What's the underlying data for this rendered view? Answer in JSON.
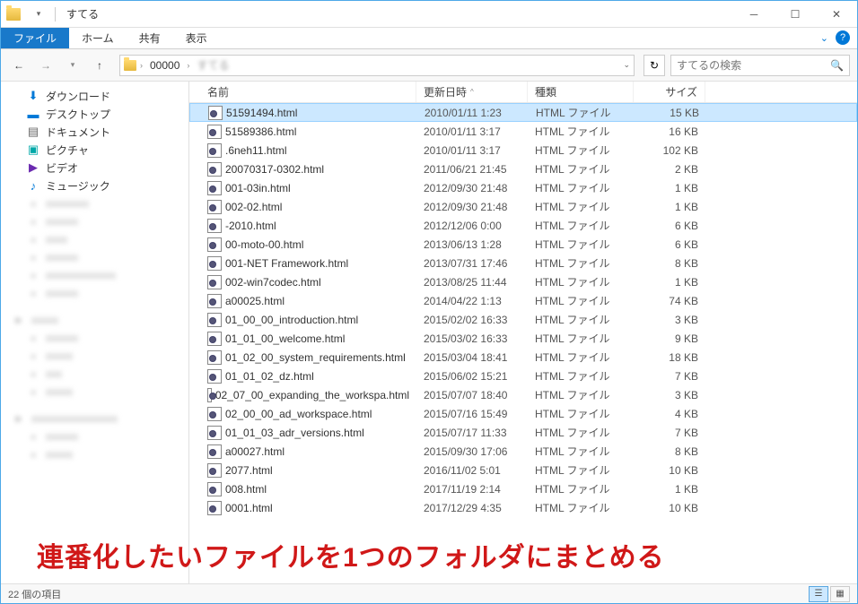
{
  "title": "すてる",
  "ribbon": {
    "file": "ファイル",
    "home": "ホーム",
    "share": "共有",
    "view": "表示"
  },
  "nav": {
    "crumb1": "00000",
    "crumb2": "すてる",
    "search_placeholder": "すてるの検索"
  },
  "sidebar": {
    "downloads": "ダウンロード",
    "desktop": "デスクトップ",
    "documents": "ドキュメント",
    "pictures": "ピクチャ",
    "videos": "ビデオ",
    "music": "ミュージック"
  },
  "columns": {
    "name": "名前",
    "date": "更新日時",
    "type": "種類",
    "size": "サイズ"
  },
  "files": [
    {
      "name": "51591494.html",
      "date": "2010/01/11 1:23",
      "type": "HTML ファイル",
      "size": "15 KB",
      "sel": true
    },
    {
      "name": "51589386.html",
      "date": "2010/01/11 3:17",
      "type": "HTML ファイル",
      "size": "16 KB"
    },
    {
      "name": ".6neh11.html",
      "date": "2010/01/11 3:17",
      "type": "HTML ファイル",
      "size": "102 KB"
    },
    {
      "name": "20070317-0302.html",
      "date": "2011/06/21 21:45",
      "type": "HTML ファイル",
      "size": "2 KB"
    },
    {
      "name": "001-03in.html",
      "date": "2012/09/30 21:48",
      "type": "HTML ファイル",
      "size": "1 KB"
    },
    {
      "name": "002-02.html",
      "date": "2012/09/30 21:48",
      "type": "HTML ファイル",
      "size": "1 KB"
    },
    {
      "name": "-2010.html",
      "date": "2012/12/06 0:00",
      "type": "HTML ファイル",
      "size": "6 KB"
    },
    {
      "name": "00-moto-00.html",
      "date": "2013/06/13 1:28",
      "type": "HTML ファイル",
      "size": "6 KB"
    },
    {
      "name": "001-NET Framework.html",
      "date": "2013/07/31 17:46",
      "type": "HTML ファイル",
      "size": "8 KB"
    },
    {
      "name": "002-win7codec.html",
      "date": "2013/08/25 11:44",
      "type": "HTML ファイル",
      "size": "1 KB"
    },
    {
      "name": "a00025.html",
      "date": "2014/04/22 1:13",
      "type": "HTML ファイル",
      "size": "74 KB"
    },
    {
      "name": "01_00_00_introduction.html",
      "date": "2015/02/02 16:33",
      "type": "HTML ファイル",
      "size": "3 KB"
    },
    {
      "name": "01_01_00_welcome.html",
      "date": "2015/03/02 16:33",
      "type": "HTML ファイル",
      "size": "9 KB"
    },
    {
      "name": "01_02_00_system_requirements.html",
      "date": "2015/03/04 18:41",
      "type": "HTML ファイル",
      "size": "18 KB"
    },
    {
      "name": "01_01_02_dz.html",
      "date": "2015/06/02 15:21",
      "type": "HTML ファイル",
      "size": "7 KB"
    },
    {
      "name": "02_07_00_expanding_the_workspa.html",
      "date": "2015/07/07 18:40",
      "type": "HTML ファイル",
      "size": "3 KB"
    },
    {
      "name": "02_00_00_ad_workspace.html",
      "date": "2015/07/16 15:49",
      "type": "HTML ファイル",
      "size": "4 KB"
    },
    {
      "name": "01_01_03_adr_versions.html",
      "date": "2015/07/17 11:33",
      "type": "HTML ファイル",
      "size": "7 KB"
    },
    {
      "name": "a00027.html",
      "date": "2015/09/30 17:06",
      "type": "HTML ファイル",
      "size": "8 KB"
    },
    {
      "name": "2077.html",
      "date": "2016/11/02 5:01",
      "type": "HTML ファイル",
      "size": "10 KB"
    },
    {
      "name": "008.html",
      "date": "2017/11/19 2:14",
      "type": "HTML ファイル",
      "size": "1 KB"
    },
    {
      "name": "0001.html",
      "date": "2017/12/29 4:35",
      "type": "HTML ファイル",
      "size": "10 KB"
    }
  ],
  "status": "22 個の項目",
  "annotation": "連番化したいファイルを1つのフォルダにまとめる"
}
